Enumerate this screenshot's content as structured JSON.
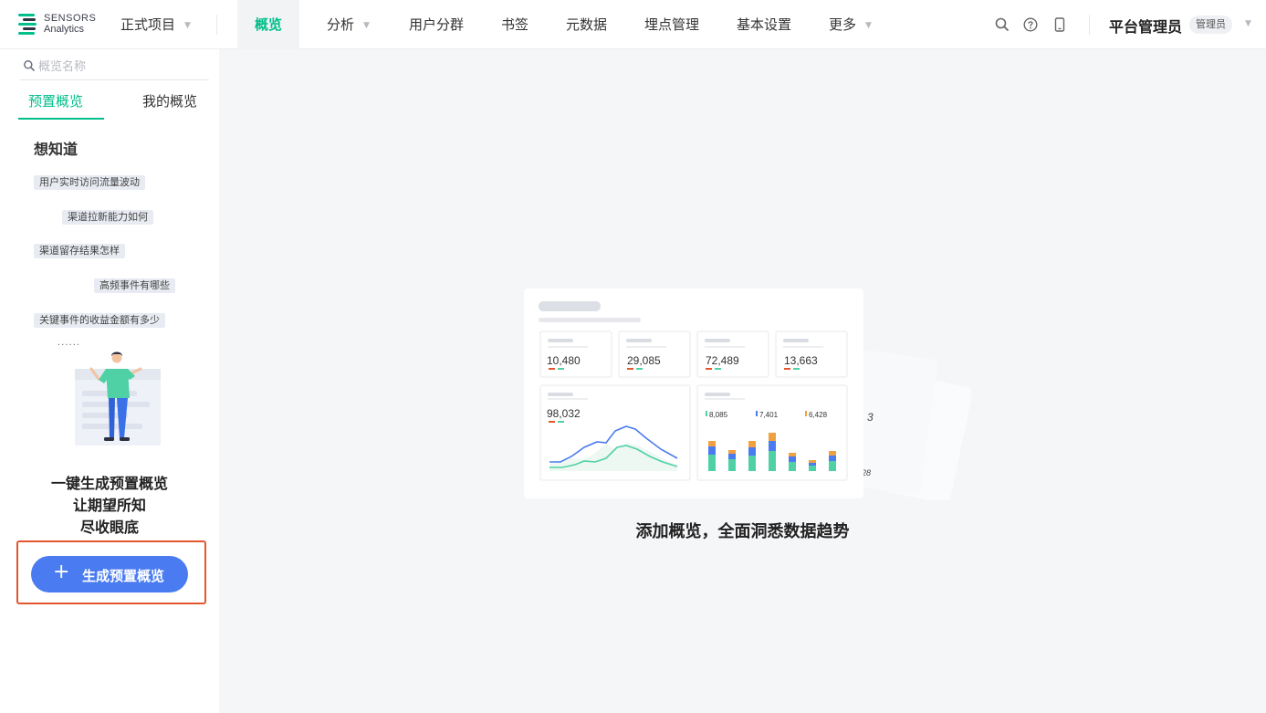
{
  "brand": {
    "line1": "SENSORS",
    "line2": "Analytics"
  },
  "project": {
    "label": "正式项目"
  },
  "nav": {
    "items": [
      {
        "label": "概览"
      },
      {
        "label": "分析"
      },
      {
        "label": "用户分群"
      },
      {
        "label": "书签"
      },
      {
        "label": "元数据"
      },
      {
        "label": "埋点管理"
      },
      {
        "label": "基本设置"
      },
      {
        "label": "更多"
      }
    ],
    "active_index": 0
  },
  "header": {
    "user_name": "平台管理员",
    "role": "管理员"
  },
  "sidebar": {
    "search_placeholder": "概览名称",
    "tabs": [
      {
        "label": "预置概览"
      },
      {
        "label": "我的概览"
      }
    ],
    "section_title": "想知道",
    "questions": [
      "用户实时访问流量波动",
      "渠道拉新能力如何",
      "渠道留存结果怎样",
      "高频事件有哪些",
      "关键事件的收益金额有多少"
    ],
    "ellipsis": "......",
    "promo_lines": [
      "一键生成预置概览",
      "让期望所知",
      "尽收眼底"
    ],
    "generate_button": "生成预置概览"
  },
  "main": {
    "empty_message": "添加概览，全面洞悉数据趋势",
    "illustration_metrics": [
      "10,480",
      "29,085",
      "72,489",
      "13,663"
    ],
    "illustration_big_metric": "98,032",
    "illustration_legend": [
      "8,085",
      "7,401",
      "6,428"
    ],
    "back_card_values": [
      "3",
      "28"
    ]
  },
  "colors": {
    "accent_green": "#00bf8a",
    "primary_blue": "#4a7bf0",
    "highlight_red": "#e4572e"
  }
}
